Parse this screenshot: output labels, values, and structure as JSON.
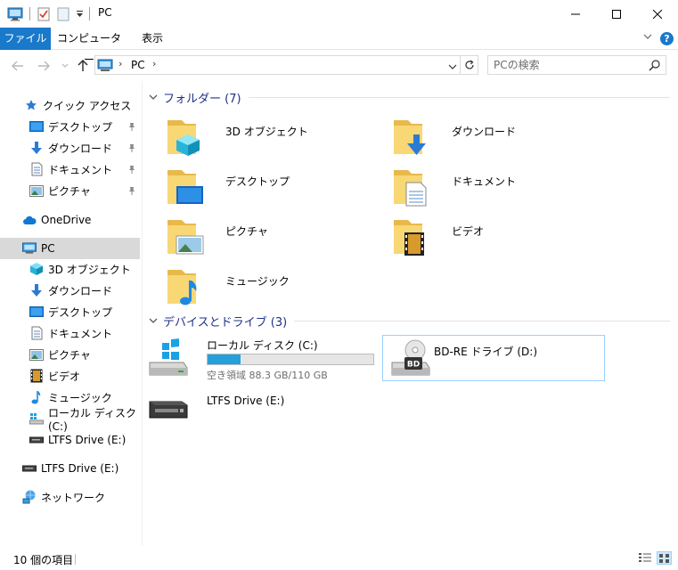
{
  "window": {
    "title": "PC"
  },
  "ribbon": {
    "tabs": [
      "ファイル",
      "コンピューター",
      "表示"
    ],
    "help": "?"
  },
  "address": {
    "segments": [
      "PC"
    ],
    "search_placeholder": "PCの検索"
  },
  "nav": {
    "quick_access": "クイック アクセス",
    "quick_items": [
      "デスクトップ",
      "ダウンロード",
      "ドキュメント",
      "ピクチャ"
    ],
    "onedrive": "OneDrive",
    "pc": "PC",
    "pc_items": [
      "3D オブジェクト",
      "ダウンロード",
      "デスクトップ",
      "ドキュメント",
      "ピクチャ",
      "ビデオ",
      "ミュージック",
      "ローカル ディスク (C:)",
      "LTFS Drive (E:)"
    ],
    "ltfs": "LTFS Drive (E:)",
    "network": "ネットワーク"
  },
  "main": {
    "folders_header": "フォルダー (7)",
    "folders": [
      "3D オブジェクト",
      "ダウンロード",
      "デスクトップ",
      "ドキュメント",
      "ピクチャ",
      "ビデオ",
      "ミュージック"
    ],
    "drives_header": "デバイスとドライブ (3)",
    "drives": [
      {
        "name": "ローカル ディスク (C:)",
        "info": "空き領域 88.3 GB/110 GB",
        "used_fraction": 0.197
      },
      {
        "name": "BD-RE ドライブ (D:)"
      },
      {
        "name": "LTFS Drive (E:)"
      }
    ]
  },
  "status": {
    "count": "10 個の項目"
  },
  "colors": {
    "accent": "#1979ca",
    "group_header": "#1e3287",
    "selection": "#d9d9d9",
    "bar_fill": "#26a0da",
    "folder": "#f8d775"
  }
}
